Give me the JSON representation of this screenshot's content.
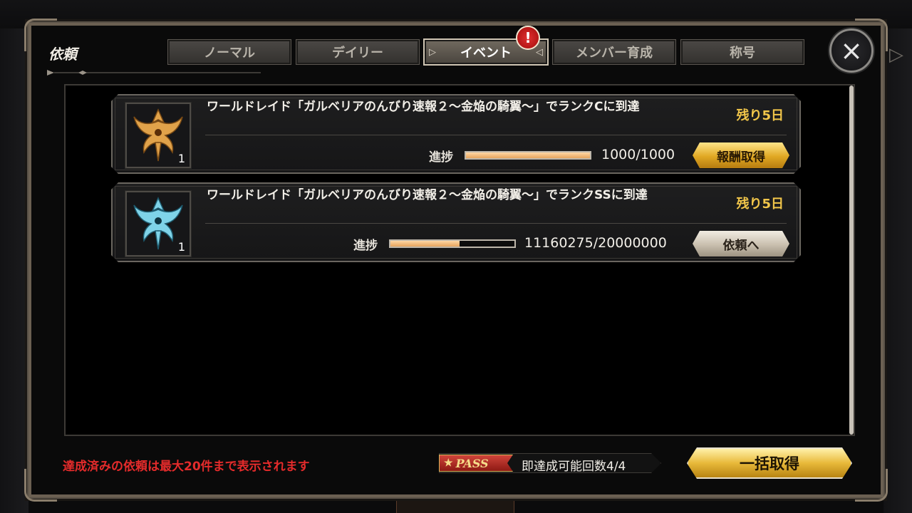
{
  "modal": {
    "title": "依頼"
  },
  "tabs": [
    {
      "label": "ノーマル",
      "active": false
    },
    {
      "label": "デイリー",
      "active": false
    },
    {
      "label": "イベント",
      "active": true
    },
    {
      "label": "メンバー育成",
      "active": false
    },
    {
      "label": "称号",
      "active": false
    }
  ],
  "alert_badge": "!",
  "close_icon": "×",
  "quests": [
    {
      "title": "ワールドレイド「ガルベリアのんびり速報２～金焔の騎翼～」でランクCに到達",
      "remaining": "残り5日",
      "progress_label": "進捗",
      "progress_value": "1000/1000",
      "progress_fraction": 1.0,
      "reward_count": "1",
      "reward_color": "#e0a24a",
      "button_label": "報酬取得",
      "button_style": "gold"
    },
    {
      "title": "ワールドレイド「ガルベリアのんびり速報２～金焔の騎翼～」でランクSSに到達",
      "remaining": "残り5日",
      "progress_label": "進捗",
      "progress_value": "11160275/20000000",
      "progress_fraction": 0.558,
      "reward_count": "1",
      "reward_color": "#7fd3e8",
      "button_label": "依頼へ",
      "button_style": "silver"
    }
  ],
  "footer": {
    "note": "達成済みの依頼は最大20件まで表示されます",
    "pass_label": "PASS",
    "pass_text": "即達成可能回数4/4",
    "bulk_button": "一括取得"
  },
  "colors": {
    "accent_gold": "#e0a823",
    "warning_red": "#e42b2b",
    "remaining_yellow": "#f2c64a"
  }
}
